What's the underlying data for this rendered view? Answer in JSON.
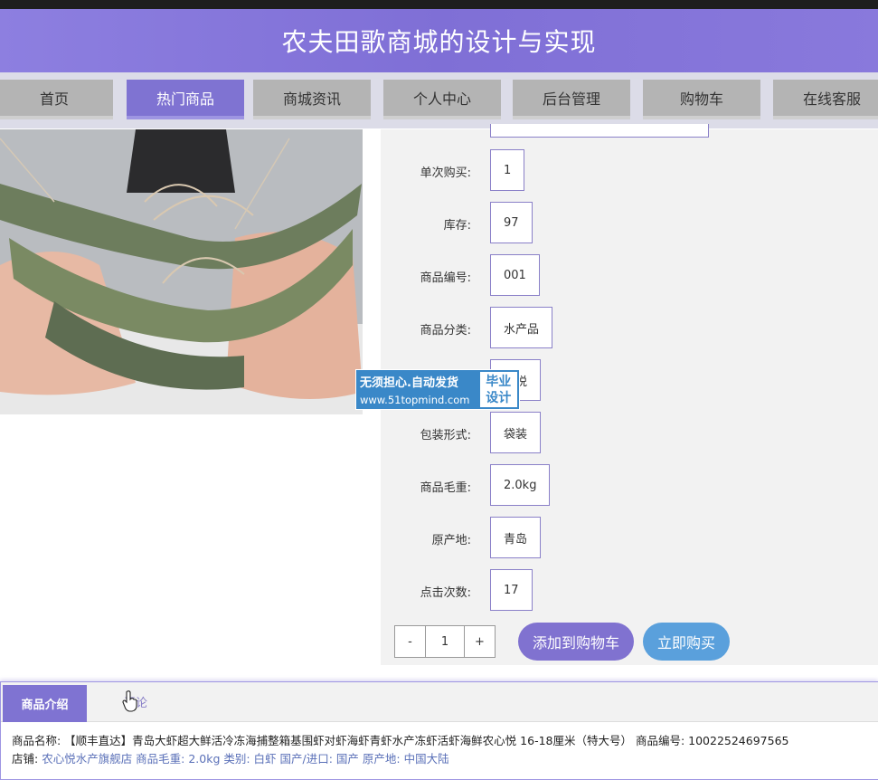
{
  "site": {
    "title": "农夫田歌商城的设计与实现"
  },
  "nav": {
    "items": [
      {
        "label": "首页"
      },
      {
        "label": "热门商品"
      },
      {
        "label": "商城资讯"
      },
      {
        "label": "个人中心"
      },
      {
        "label": "后台管理"
      },
      {
        "label": "购物车"
      },
      {
        "label": "在线客服"
      }
    ],
    "active": "热门商品"
  },
  "details": {
    "fields": [
      {
        "label": "单次购买:",
        "value": "1"
      },
      {
        "label": "库存:",
        "value": "97"
      },
      {
        "label": "商品编号:",
        "value": "001"
      },
      {
        "label": "商品分类:",
        "value": "水产品"
      },
      {
        "label": "",
        "value": "心悦"
      },
      {
        "label": "包装形式:",
        "value": "袋装"
      },
      {
        "label": "商品毛重:",
        "value": "2.0kg"
      },
      {
        "label": "原产地:",
        "value": "青岛"
      },
      {
        "label": "点击次数:",
        "value": "17"
      }
    ]
  },
  "purchase": {
    "minus": "-",
    "quantity": "1",
    "plus": "+",
    "add_to_cart": "添加到购物车",
    "buy_now": "立即购买"
  },
  "watermark": {
    "line1": "无须担心.自动发货",
    "line2": "www.51topmind.com",
    "badge_line1": "毕业",
    "badge_line2": "设计"
  },
  "tabs": {
    "active": "商品介绍",
    "other": "评论"
  },
  "description": {
    "line1": "商品名称: 【顺丰直达】青岛大虾超大鲜活冷冻海捕整箱基围虾对虾海虾青虾水产冻虾活虾海鲜农心悦 16-18厘米（特大号） 商品编号: 10022524697565",
    "line2_label": "店铺: ",
    "line2_rest": "农心悦水产旗舰店 商品毛重: 2.0kg 类别: 白虾 国产/进口: 国产 原产地: 中国大陆"
  },
  "colors": {
    "brand": "#8072d0",
    "buy": "#5aa0dc",
    "nav_bg": "#b4b4b4",
    "panel_bg": "#f2f2f2"
  }
}
